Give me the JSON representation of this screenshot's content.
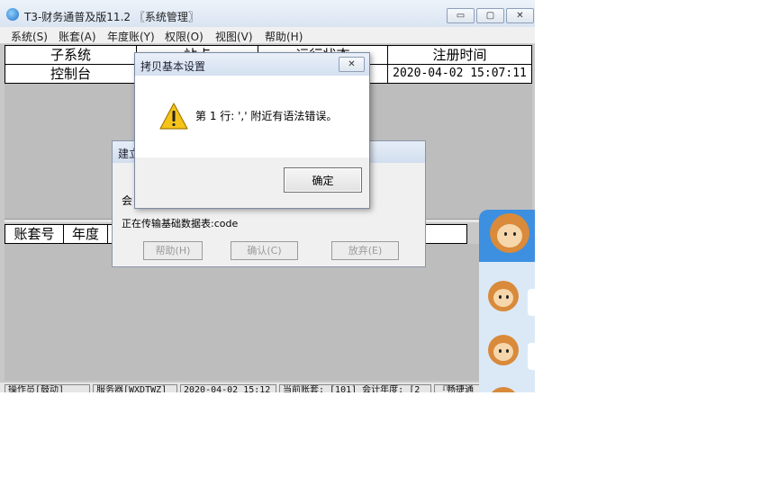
{
  "window": {
    "title": "T3-财务通普及版11.2 〖系统管理〗",
    "minimize_label": "▭",
    "maximize_label": "▢",
    "close_label": "✕"
  },
  "menu": [
    {
      "label": "系统(S)"
    },
    {
      "label": "账套(A)"
    },
    {
      "label": "年度账(Y)"
    },
    {
      "label": "权限(O)"
    },
    {
      "label": "视图(V)"
    },
    {
      "label": "帮助(H)"
    }
  ],
  "top_grid": {
    "headers": [
      "子系统",
      "站点",
      "运行状态",
      "注册时间"
    ],
    "row": [
      "控制台",
      "",
      "",
      "2020-04-02 15:07:11"
    ]
  },
  "bottom_grid": {
    "headers": [
      "账套号",
      "年度"
    ]
  },
  "status_bar": [
    "操作员[鼓动]",
    "服务器[WXDTWZ]",
    "2020-04-02 15:12",
    "当前账套: [101] 会计年度: [2",
    "『畅捷通"
  ],
  "build_dialog": {
    "title": "建立",
    "label2": "会",
    "progress_text": "正在传输基础数据表:code",
    "buttons": [
      "帮助(H)",
      "确认(C)",
      "放弃(E)"
    ]
  },
  "error_dialog": {
    "title": "拷贝基本设置",
    "message": "第 1 行: ',' 附近有语法错误。",
    "ok_label": "确定",
    "close_label": "✕"
  },
  "icons": {
    "app": "app-cloud-icon",
    "warning": "warning-icon",
    "mascot": "monkey-mascot-icon"
  },
  "colors": {
    "titlebar": "#d9e4f2",
    "pane_gray": "#bdbdbd",
    "dialog_bg": "#f0f0f0",
    "widget_blue": "#3d8fe0"
  }
}
